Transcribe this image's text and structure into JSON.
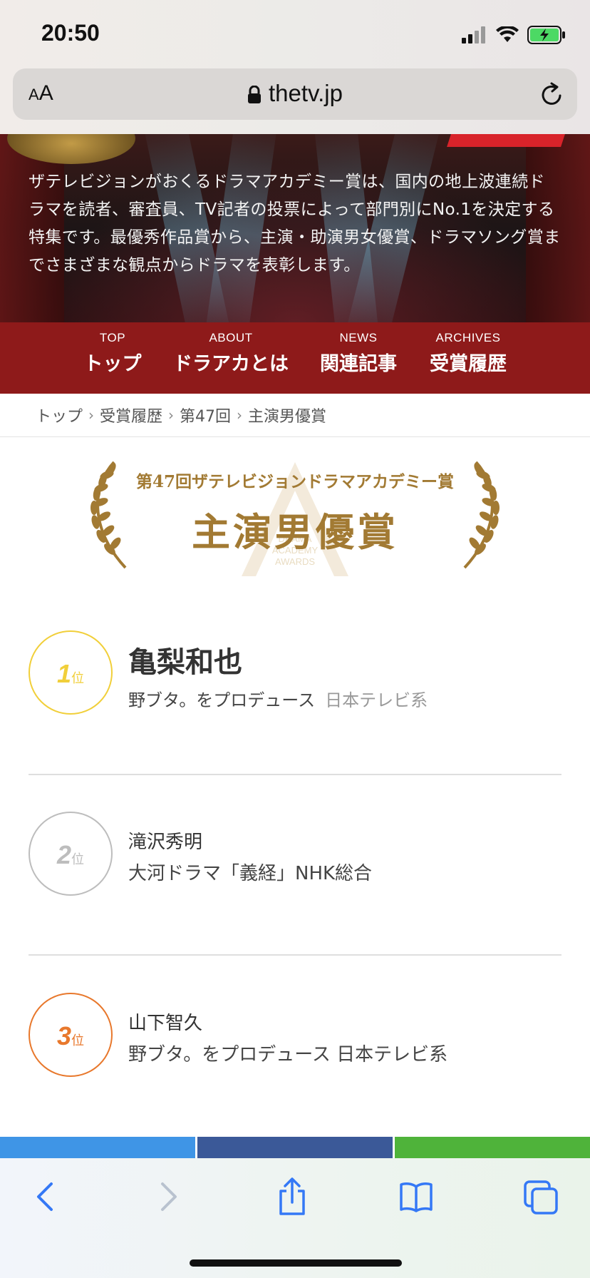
{
  "status": {
    "time": "20:50"
  },
  "browser": {
    "aa_label": "AA",
    "domain": "thetv.jp"
  },
  "hero": {
    "description": "ザテレビジョンがおくるドラマアカデミー賞は、国内の地上波連続ドラマを読者、審査員、TV記者の投票によって部門別にNo.1を決定する特集です。最優秀作品賞から、主演・助演男女優賞、ドラマソング賞までさまざまな観点からドラマを表彰します。"
  },
  "nav": [
    {
      "en": "TOP",
      "ja": "トップ"
    },
    {
      "en": "ABOUT",
      "ja": "ドラアカとは"
    },
    {
      "en": "NEWS",
      "ja": "関連記事"
    },
    {
      "en": "ARCHIVES",
      "ja": "受賞履歴"
    }
  ],
  "breadcrumb": [
    "トップ",
    "受賞履歴",
    "第47回",
    "主演男優賞"
  ],
  "award": {
    "subtitle": "第47回ザテレビジョンドラマアカデミー賞",
    "title": "主演男優賞",
    "watermark": [
      "DRAMA",
      "ACADEMY",
      "AWARDS"
    ]
  },
  "rank_unit": "位",
  "ranks": [
    {
      "rank": "1",
      "name": "亀梨和也",
      "show": "野ブタ。をプロデュース",
      "network": "日本テレビ系",
      "color": "#f1cf3a"
    },
    {
      "rank": "2",
      "name": "滝沢秀明",
      "show": "大河ドラマ「義経」NHK総合",
      "network": "",
      "color": "#bdbdbd"
    },
    {
      "rank": "3",
      "name": "山下智久",
      "show": "野ブタ。をプロデュース 日本テレビ系",
      "network": "",
      "color": "#e8782c"
    }
  ],
  "share_colors": [
    "#3f95e6",
    "#3b5998",
    "#4fb33a"
  ],
  "colors": {
    "accent_gold": "#a27a33",
    "nav_red": "#8e1a1a",
    "ios_blue": "#3478f6"
  }
}
